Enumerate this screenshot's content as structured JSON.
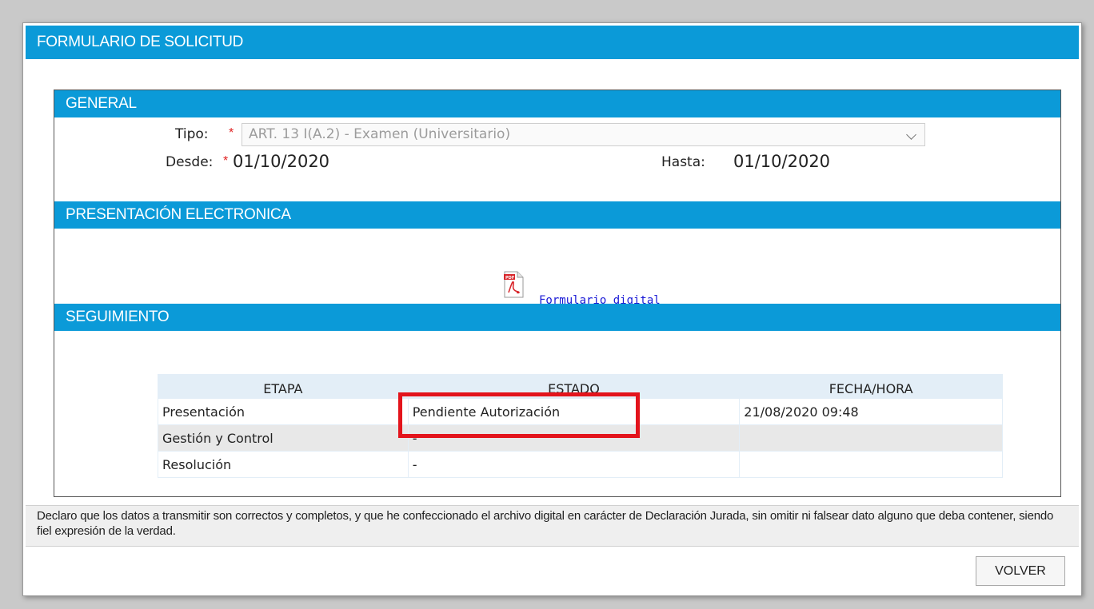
{
  "form": {
    "title": "FORMULARIO DE SOLICITUD"
  },
  "general": {
    "header": "GENERAL",
    "tipo_label": "Tipo:",
    "tipo_value": "ART. 13 I(A.2) - Examen (Universitario)",
    "required_mark": "*",
    "desde_label": "Desde:",
    "desde_value": "01/10/2020",
    "hasta_label": "Hasta:",
    "hasta_value": "01/10/2020"
  },
  "presentacion": {
    "header": "PRESENTACIÓN ELECTRONICA",
    "link_label": "Formulario digital",
    "icon": "pdf-icon"
  },
  "seguimiento": {
    "header": "SEGUIMIENTO",
    "columns": [
      "ETAPA",
      "ESTADO",
      "FECHA/HORA"
    ],
    "rows": [
      [
        "Presentación",
        "Pendiente Autorización",
        "21/08/2020 09:48"
      ],
      [
        "Gestión y Control",
        "-",
        ""
      ],
      [
        "Resolución",
        "-",
        ""
      ]
    ],
    "highlight_color": "#e3141c"
  },
  "declaration": "Declaro que los datos a transmitir son correctos y completos, y que he confeccionado el archivo digital en carácter de Declaración Jurada, sin omitir ni falsear dato alguno que deba contener, siendo fiel expresión de la verdad.",
  "buttons": {
    "volver": "VOLVER"
  },
  "colors": {
    "header_blue": "#0b9ad8",
    "required_red": "#e02020",
    "link_blue": "#1a1ad6"
  }
}
